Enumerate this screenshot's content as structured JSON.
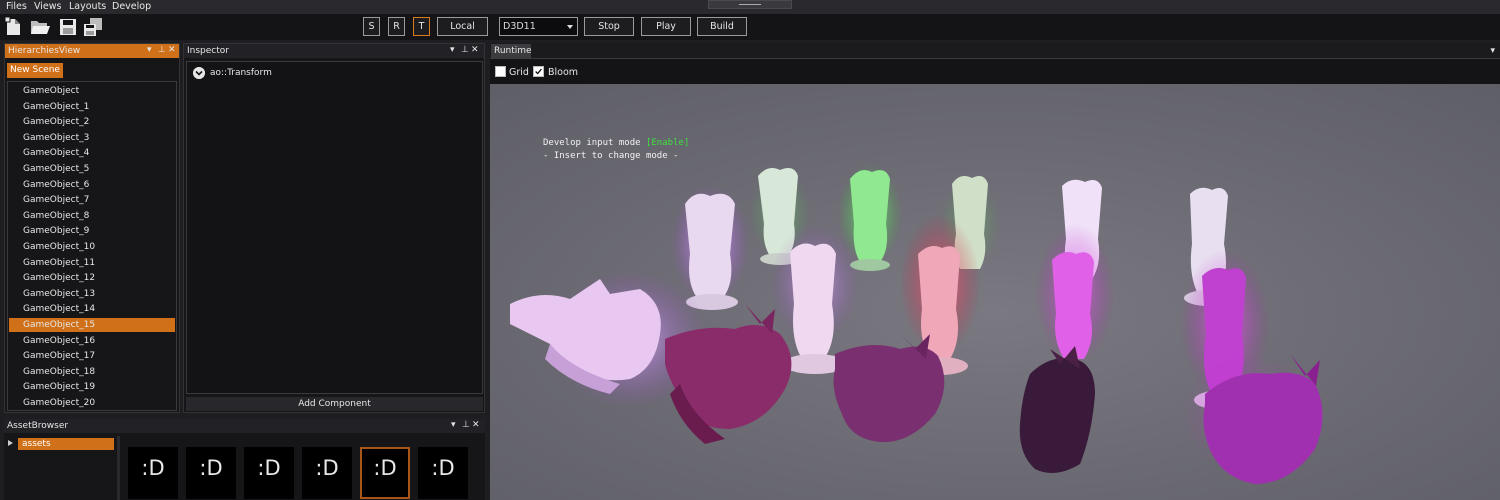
{
  "menu": [
    "Files",
    "Views",
    "Layouts",
    "Develop"
  ],
  "toolbar": {
    "icons": [
      "new-file-icon",
      "open-folder-icon",
      "save-icon",
      "save-all-icon"
    ],
    "transform_modes": [
      "S",
      "R",
      "T"
    ],
    "active_mode": "T",
    "space": "Local",
    "graphics_api": "D3D11",
    "stop": "Stop",
    "play": "Play",
    "build": "Build",
    "accent_color": "#d0711a"
  },
  "hierarchy": {
    "title": "HierarchiesView",
    "new_scene": "New Scene",
    "selected_index": 15,
    "items": [
      "GameObject",
      "GameObject_1",
      "GameObject_2",
      "GameObject_3",
      "GameObject_4",
      "GameObject_5",
      "GameObject_6",
      "GameObject_7",
      "GameObject_8",
      "GameObject_9",
      "GameObject_10",
      "GameObject_11",
      "GameObject_12",
      "GameObject_13",
      "GameObject_14",
      "GameObject_15",
      "GameObject_16",
      "GameObject_17",
      "GameObject_18",
      "GameObject_19",
      "GameObject_20"
    ]
  },
  "inspector": {
    "title": "Inspector",
    "component": "ao::Transform",
    "add_component": "Add Component"
  },
  "asset_browser": {
    "title": "AssetBrowser",
    "folder": "assets",
    "thumbnails": [
      ":D",
      ":D",
      ":D",
      ":D",
      ":D",
      ":D"
    ],
    "selected_index": 4
  },
  "runtime": {
    "tab": "Runtime",
    "grid_label": "Grid",
    "grid_checked": false,
    "bloom_label": "Bloom",
    "bloom_checked": true,
    "overlay_prefix": "Develop input mode ",
    "overlay_status": "[Enable]",
    "overlay_line2": "- Insert to change mode -"
  },
  "panel_controls": {
    "menu": "▾",
    "pin": "⊥",
    "close": "✕"
  }
}
